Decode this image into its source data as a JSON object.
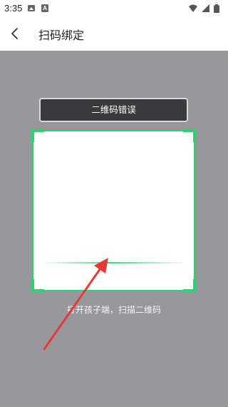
{
  "status_bar": {
    "time": "3:35",
    "icons": [
      "image-icon",
      "a-icon",
      "wifi-icon",
      "signal-icon",
      "battery-icon"
    ]
  },
  "app_bar": {
    "back_icon": "chevron-left-icon",
    "title": "扫码绑定"
  },
  "scanner": {
    "error_banner": "二维码错误",
    "hint": "打开孩子端，扫描二维码",
    "frame_color": "#2bd46e",
    "overlay_color": "#98989c"
  },
  "annotation": {
    "arrow_color": "#e53935"
  }
}
